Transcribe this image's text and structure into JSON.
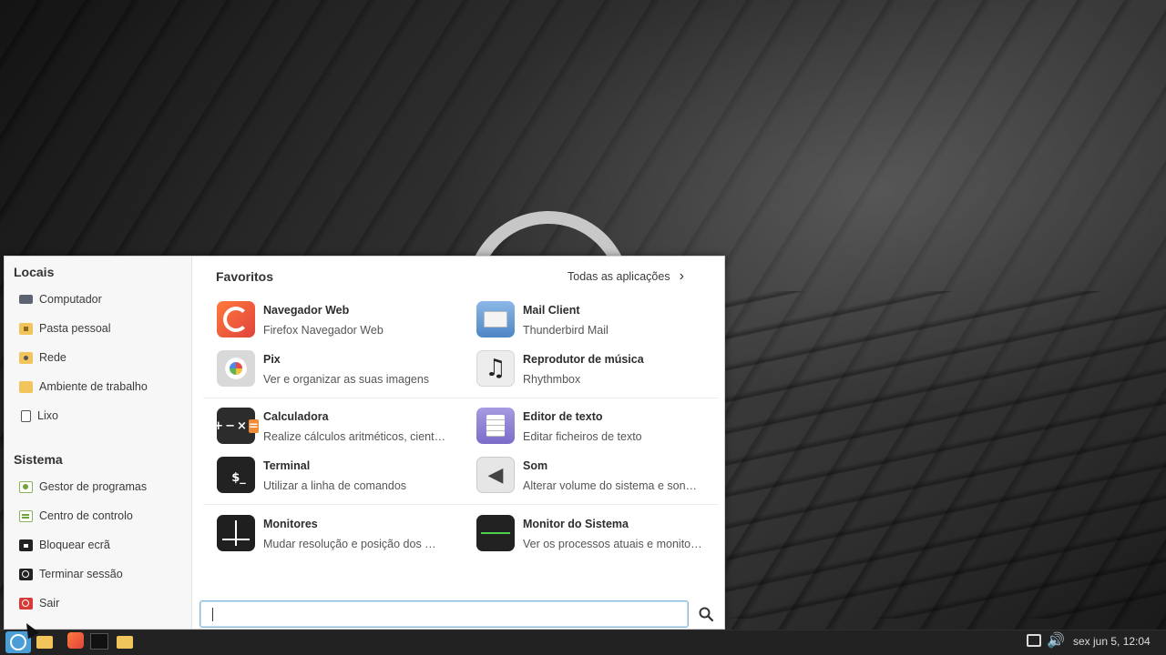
{
  "sidebar": {
    "places_title": "Locais",
    "places": [
      {
        "label": "Computador",
        "icon": "computer-icon"
      },
      {
        "label": "Pasta pessoal",
        "icon": "home-folder-icon"
      },
      {
        "label": "Rede",
        "icon": "network-folder-icon"
      },
      {
        "label": "Ambiente de trabalho",
        "icon": "desktop-folder-icon"
      },
      {
        "label": "Lixo",
        "icon": "trash-icon"
      }
    ],
    "system_title": "Sistema",
    "system": [
      {
        "label": "Gestor de programas",
        "icon": "software-manager-icon"
      },
      {
        "label": "Centro de controlo",
        "icon": "control-center-icon"
      },
      {
        "label": "Bloquear ecrã",
        "icon": "lock-icon"
      },
      {
        "label": "Terminar sessão",
        "icon": "logout-icon"
      },
      {
        "label": "Sair",
        "icon": "power-icon"
      }
    ]
  },
  "favorites": {
    "title": "Favoritos",
    "all_apps_label": "Todas as aplicações",
    "apps": [
      {
        "name": "Navegador Web",
        "desc": "Firefox Navegador Web",
        "icon": "firefox-icon"
      },
      {
        "name": "Mail Client",
        "desc": "Thunderbird Mail",
        "icon": "mail-icon"
      },
      {
        "name": "Pix",
        "desc": "Ver e organizar as suas imagens",
        "icon": "pix-icon"
      },
      {
        "name": "Reprodutor de música",
        "desc": "Rhythmbox",
        "icon": "music-note-icon"
      },
      {
        "name": "Calculadora",
        "desc": "Realize cálculos aritméticos, cient…",
        "icon": "calculator-icon"
      },
      {
        "name": "Editor de texto",
        "desc": "Editar ficheiros de texto",
        "icon": "text-editor-icon"
      },
      {
        "name": "Terminal",
        "desc": "Utilizar a linha de comandos",
        "icon": "terminal-icon"
      },
      {
        "name": "Som",
        "desc": "Alterar volume do sistema e son…",
        "icon": "speaker-icon"
      },
      {
        "name": "Monitores",
        "desc": "Mudar resolução e posição dos …",
        "icon": "monitors-icon"
      },
      {
        "name": "Monitor do Sistema",
        "desc": "Ver os processos atuais e monito…",
        "icon": "system-monitor-icon"
      }
    ]
  },
  "search": {
    "value": "",
    "placeholder": ""
  },
  "taskbar": {
    "clock": "sex jun  5, 12:04",
    "launchers": [
      "menu-icon",
      "folder-icon",
      "firefox-icon",
      "terminal-icon",
      "folder-icon"
    ]
  },
  "colors": {
    "accent": "#4a9ed8",
    "taskbar": "#222222"
  }
}
